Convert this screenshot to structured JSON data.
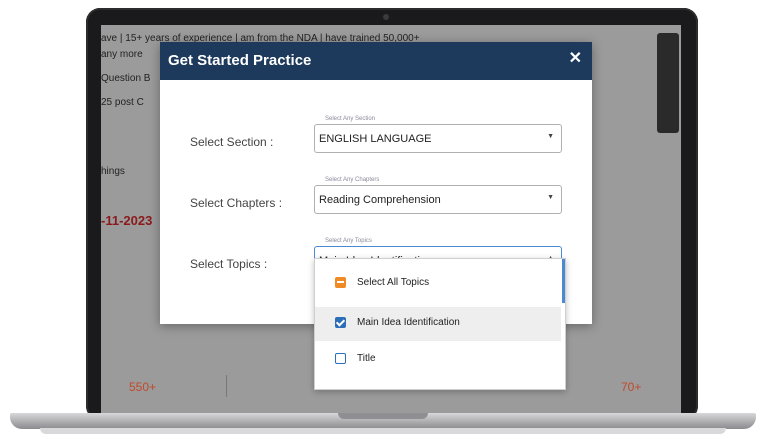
{
  "background_page": {
    "line1": "ave | 15+ years of experience | am from the NDA | have trained 50,000+",
    "line2": "any more",
    "line3": "Question B",
    "line4": "25 post C",
    "line5": "hings",
    "date": "-11-2023",
    "stat_left": "550+",
    "stat_right": "70+"
  },
  "modal": {
    "title": "Get Started Practice",
    "close_icon": "close-icon",
    "fields": [
      {
        "label": "Select Section :",
        "hint": "Select Any Section",
        "value": "ENGLISH LANGUAGE"
      },
      {
        "label": "Select Chapters :",
        "hint": "Select Any Chapters",
        "value": "Reading Comprehension"
      },
      {
        "label": "Select Topics :",
        "hint": "Select Any Topics",
        "value": "Main Idea Identification"
      }
    ]
  },
  "dropdown": {
    "items": [
      {
        "label": "Select All Topics",
        "state": "partial"
      },
      {
        "label": "Main Idea Identification",
        "state": "checked"
      },
      {
        "label": "Title",
        "state": "unchecked"
      }
    ]
  },
  "colors": {
    "header": "#1d3a5c",
    "accent_blue": "#2c6fb8",
    "accent_orange": "#f08a24"
  }
}
